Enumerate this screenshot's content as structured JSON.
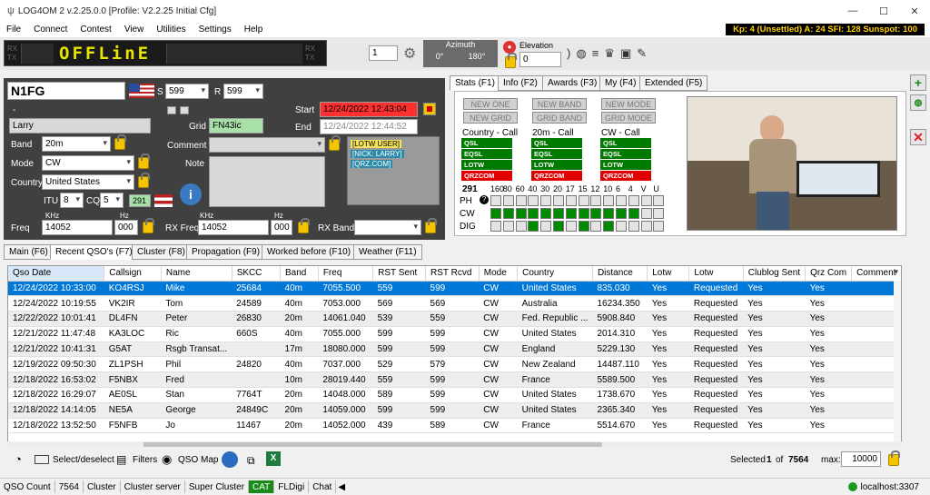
{
  "window": {
    "title": "LOG4OM 2 v.2.25.0.0 [Profile: V2.2.25 Initial Cfg]",
    "minimize": "—",
    "maximize": "☐",
    "close": "✕"
  },
  "menu": [
    "File",
    "Connect",
    "Contest",
    "View",
    "Utilities",
    "Settings",
    "Help"
  ],
  "solar": "Kp: 4 (Unsettled)  A: 24  SFI: 128 Sunspot: 100",
  "radio": {
    "rx": "RX",
    "tx": "TX",
    "status": "OFFLinE",
    "offset": "1",
    "azimuth_label": "Azimuth",
    "az1": "0°",
    "az2": "180°",
    "elevation_label": "Elevation",
    "elevation": "0"
  },
  "qso": {
    "callsign": "N1FG",
    "s_label": "S",
    "s_value": "599",
    "r_label": "R",
    "r_value": "599",
    "dash": "-",
    "name": "Larry",
    "grid_label": "Grid",
    "grid": "FN43ic",
    "start_label": "Start",
    "start": "12/24/2022 12:43:04",
    "end_label": "End",
    "end": "12/24/2022 12:44:52",
    "band_label": "Band",
    "band": "20m",
    "mode_label": "Mode",
    "mode": "CW",
    "country_label": "Country",
    "country": "United States",
    "itu_label": "ITU",
    "itu": "8",
    "cq_label": "CQ",
    "cq": "5",
    "dxcc": "291",
    "comment_label": "Comment",
    "note_label": "Note",
    "freq_label": "Freq",
    "khz": "KHz",
    "hz": "Hz",
    "freq_khz": "14052",
    "freq_hz": "000",
    "rxfreq_label": "RX Freq",
    "rx_khz": "14052",
    "rx_hz": "000",
    "rxband_label": "RX Band",
    "tags": [
      "[LOTW USER]",
      "[NICK: LARRY]",
      "[QRZ.COM]"
    ]
  },
  "stats": {
    "tabs": [
      "Stats (F1)",
      "Info (F2)",
      "Awards (F3)",
      "My (F4)",
      "Extended (F5)"
    ],
    "buttons": [
      "NEW ONE",
      "NEW BAND",
      "NEW MODE",
      "NEW GRID",
      "GRID BAND",
      "GRID MODE"
    ],
    "columns": [
      {
        "title": "Country - Call",
        "items": [
          {
            "t": "QSL",
            "c": "g"
          },
          {
            "t": "EQSL",
            "c": "g"
          },
          {
            "t": "LOTW",
            "c": "g"
          },
          {
            "t": "QRZCOM",
            "c": "r"
          }
        ]
      },
      {
        "title": "20m - Call",
        "items": [
          {
            "t": "QSL",
            "c": "g"
          },
          {
            "t": "EQSL",
            "c": "g"
          },
          {
            "t": "LOTW",
            "c": "g"
          },
          {
            "t": "QRZCOM",
            "c": "r"
          }
        ]
      },
      {
        "title": "CW - Call",
        "items": [
          {
            "t": "QSL",
            "c": "g"
          },
          {
            "t": "EQSL",
            "c": "g"
          },
          {
            "t": "LOTW",
            "c": "g"
          },
          {
            "t": "QRZCOM",
            "c": "r"
          }
        ]
      }
    ],
    "dxcc": "291",
    "bands": [
      "160",
      "80",
      "60",
      "40",
      "30",
      "20",
      "17",
      "15",
      "12",
      "10",
      "6",
      "4",
      "V",
      "U"
    ],
    "rows": [
      {
        "label": "PH",
        "cells": [
          0,
          0,
          0,
          0,
          0,
          0,
          0,
          0,
          0,
          0,
          0,
          0,
          0,
          0
        ]
      },
      {
        "label": "CW",
        "cells": [
          1,
          1,
          1,
          1,
          1,
          1,
          1,
          1,
          1,
          1,
          1,
          1,
          0,
          0
        ]
      },
      {
        "label": "DIG",
        "cells": [
          0,
          0,
          0,
          1,
          0,
          1,
          0,
          1,
          0,
          1,
          0,
          0,
          0,
          0
        ]
      }
    ]
  },
  "main_tabs": [
    "Main (F6)",
    "Recent QSO's (F7)",
    "Cluster (F8)",
    "Propagation (F9)",
    "Worked before (F10)",
    "Weather (F11)"
  ],
  "grid": {
    "headers": [
      "Qso Date",
      "Callsign",
      "Name",
      "SKCC",
      "Band",
      "Freq",
      "RST Sent",
      "RST Rcvd",
      "Mode",
      "Country",
      "Distance",
      "Lotw",
      "Lotw",
      "Clublog Sent",
      "Qrz Com",
      "Comment"
    ],
    "rows": [
      [
        "12/24/2022 10:33:00",
        "KO4RSJ",
        "Mike",
        "25684",
        "40m",
        "7055.500",
        "559",
        "599",
        "CW",
        "United States",
        "835.030",
        "Yes",
        "Requested",
        "Yes",
        "Yes",
        ""
      ],
      [
        "12/24/2022 10:19:55",
        "VK2IR",
        "Tom",
        "24589",
        "40m",
        "7053.000",
        "569",
        "569",
        "CW",
        "Australia",
        "16234.350",
        "Yes",
        "Requested",
        "Yes",
        "Yes",
        ""
      ],
      [
        "12/22/2022 10:01:41",
        "DL4FN",
        "Peter",
        "26830",
        "20m",
        "14061.040",
        "539",
        "559",
        "CW",
        "Fed. Republic ...",
        "5908.840",
        "Yes",
        "Requested",
        "Yes",
        "Yes",
        ""
      ],
      [
        "12/21/2022 11:47:48",
        "KA3LOC",
        "Ric",
        "660S",
        "40m",
        "7055.000",
        "599",
        "599",
        "CW",
        "United States",
        "2014.310",
        "Yes",
        "Requested",
        "Yes",
        "Yes",
        ""
      ],
      [
        "12/21/2022 10:41:31",
        "G5AT",
        "Rsgb Transat...",
        "",
        "17m",
        "18080.000",
        "599",
        "599",
        "CW",
        "England",
        "5229.130",
        "Yes",
        "Requested",
        "Yes",
        "Yes",
        ""
      ],
      [
        "12/19/2022 09:50:30",
        "ZL1PSH",
        "Phil",
        "24820",
        "40m",
        "7037.000",
        "529",
        "579",
        "CW",
        "New Zealand",
        "14487.110",
        "Yes",
        "Requested",
        "Yes",
        "Yes",
        ""
      ],
      [
        "12/18/2022 16:53:02",
        "F5NBX",
        "Fred",
        "",
        "10m",
        "28019.440",
        "559",
        "599",
        "CW",
        "France",
        "5589.500",
        "Yes",
        "Requested",
        "Yes",
        "Yes",
        ""
      ],
      [
        "12/18/2022 16:29:07",
        "AE0SL",
        "Stan",
        "7764T",
        "20m",
        "14048.000",
        "589",
        "599",
        "CW",
        "United States",
        "1738.670",
        "Yes",
        "Requested",
        "Yes",
        "Yes",
        ""
      ],
      [
        "12/18/2022 14:14:05",
        "NE5A",
        "George",
        "24849C",
        "20m",
        "14059.000",
        "599",
        "599",
        "CW",
        "United States",
        "2365.340",
        "Yes",
        "Requested",
        "Yes",
        "Yes",
        ""
      ],
      [
        "12/18/2022 13:52:50",
        "F5NFB",
        "Jo",
        "11467",
        "20m",
        "14052.000",
        "439",
        "589",
        "CW",
        "France",
        "5514.670",
        "Yes",
        "Requested",
        "Yes",
        "Yes",
        ""
      ]
    ]
  },
  "bottom": {
    "select": "Select/deselect",
    "filters": "Filters",
    "qso_map": "QSO Map",
    "selected_label": "Selected",
    "selected": "1",
    "of": "of",
    "total": "7564",
    "max_label": "max:",
    "max": "10000"
  },
  "status": {
    "qso_count_label": "QSO Count",
    "qso_count": "7564",
    "items": [
      "Cluster",
      "Cluster server",
      "Super Cluster",
      "CAT",
      "FLDigi",
      "Chat"
    ],
    "server": "localhost:3307"
  }
}
